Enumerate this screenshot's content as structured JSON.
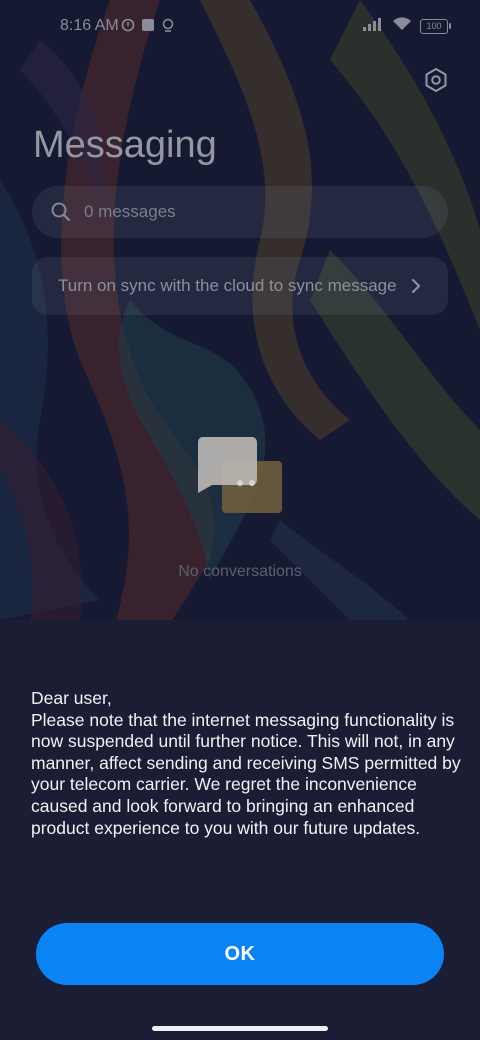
{
  "status_bar": {
    "time": "8:16 AM",
    "battery": "100",
    "icons": [
      "notification-icon",
      "app-icon",
      "vpn-icon",
      "signal-icon",
      "wifi-icon",
      "battery-icon"
    ]
  },
  "header": {
    "title": "Messaging",
    "settings_icon": "settings-icon"
  },
  "search": {
    "placeholder": "0 messages",
    "value": ""
  },
  "sync_banner": {
    "text": "Turn on sync with the cloud to sync messages"
  },
  "empty_state": {
    "label": "No conversations",
    "icon": "chat-bubbles-icon"
  },
  "dialog": {
    "message": "Dear user,\nPlease note that the internet messaging functionality is now suspended until further notice. This will not, in any manner, affect sending and receiving SMS permitted by your telecom carrier. We regret the inconvenience caused and look forward to bringing an enhanced product experience to you with our future updates.",
    "ok_label": "OK"
  },
  "colors": {
    "accent": "#0a84f5",
    "sheet_bg": "#1a1d33",
    "bubble_front": "#b9b6b3",
    "bubble_back": "#6e5d3c"
  }
}
